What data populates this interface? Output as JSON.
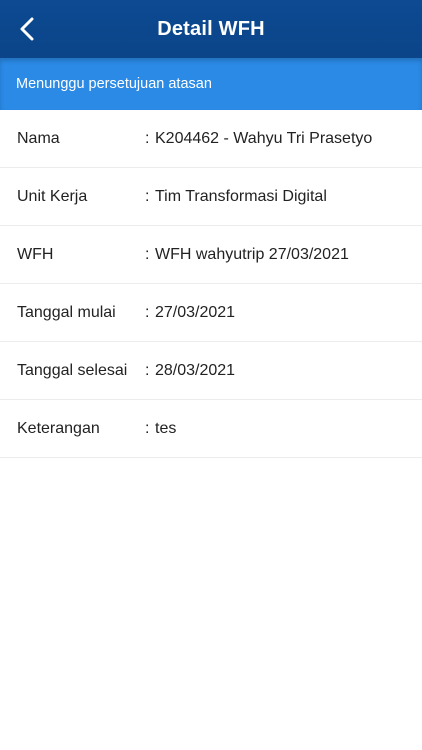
{
  "header": {
    "title": "Detail WFH",
    "back_icon": "chevron-left-icon"
  },
  "status": {
    "text": "Menunggu persetujuan atasan"
  },
  "colors": {
    "header_bg": "#0b4488",
    "status_bg": "#2a8ae6",
    "text": "#222222"
  },
  "details": [
    {
      "label": "Nama",
      "separator": ":",
      "value": "K204462 - Wahyu Tri Prasetyo"
    },
    {
      "label": "Unit Kerja",
      "separator": ":",
      "value": "Tim Transformasi Digital"
    },
    {
      "label": "WFH",
      "separator": ":",
      "value": "WFH wahyutrip 27/03/2021"
    },
    {
      "label": "Tanggal mulai",
      "separator": ":",
      "value": "27/03/2021"
    },
    {
      "label": "Tanggal selesai",
      "separator": ":",
      "value": "28/03/2021"
    },
    {
      "label": "Keterangan",
      "separator": ":",
      "value": "tes"
    }
  ]
}
